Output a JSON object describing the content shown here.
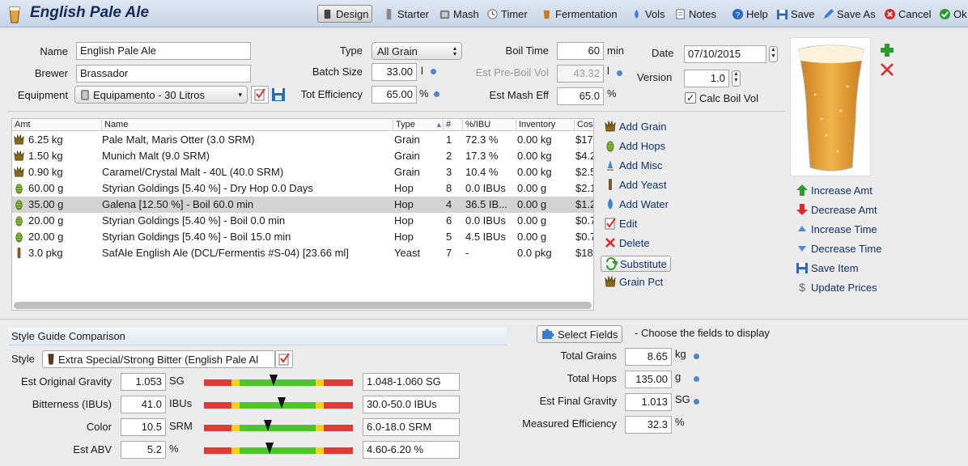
{
  "window": {
    "title": "English Pale Ale"
  },
  "toolbar": [
    {
      "label": "Design",
      "icon": "design-icon",
      "active": true
    },
    {
      "label": "Starter",
      "icon": "starter-icon"
    },
    {
      "label": "Mash",
      "icon": "mash-icon"
    },
    {
      "label": "Timer",
      "icon": "timer-icon"
    },
    {
      "label": "Fermentation",
      "icon": "fermentation-icon"
    },
    {
      "label": "Vols",
      "icon": "vols-icon"
    },
    {
      "label": "Notes",
      "icon": "notes-icon"
    },
    {
      "label": "Help",
      "icon": "help-icon"
    },
    {
      "label": "Save",
      "icon": "save-icon"
    },
    {
      "label": "Save As",
      "icon": "save-as-icon"
    },
    {
      "label": "Cancel",
      "icon": "cancel-icon"
    },
    {
      "label": "Ok",
      "icon": "ok-icon"
    }
  ],
  "recipe": {
    "name_label": "Name",
    "name": "English Pale Ale",
    "brewer_label": "Brewer",
    "brewer": "Brassador",
    "equipment_label": "Equipment",
    "equipment": "Equipamento - 30 Litros",
    "type_label": "Type",
    "type": "All Grain",
    "batch_label": "Batch Size",
    "batch": "33.00",
    "batch_unit": "l",
    "eff_label": "Tot Efficiency",
    "eff": "65.00",
    "eff_unit": "%",
    "boil_label": "Boil Time",
    "boil": "60",
    "boil_unit": "min",
    "preboil_label": "Est Pre-Boil Vol",
    "preboil": "43.32",
    "preboil_unit": "l",
    "mash_eff_label": "Est Mash Eff",
    "mash_eff": "65.0",
    "mash_eff_unit": "%",
    "date_label": "Date",
    "date": "07/10/2015",
    "version_label": "Version",
    "version": "1.0",
    "calc_boil_label": "Calc Boil Vol",
    "calc_boil": true
  },
  "ingredients": {
    "columns": [
      "Amt",
      "Name",
      "Type",
      "#",
      "%/IBU",
      "Inventory",
      "Cos"
    ],
    "rows": [
      {
        "icon": "grain-icon",
        "amt": "6.25 kg",
        "name": "Pale Malt, Maris Otter (3.0 SRM)",
        "type": "Grain",
        "num": "1",
        "pct": "72.3 %",
        "inv": "0.00 kg",
        "cost": "$17"
      },
      {
        "icon": "grain-icon",
        "amt": "1.50 kg",
        "name": "Munich Malt (9.0 SRM)",
        "type": "Grain",
        "num": "2",
        "pct": "17.3 %",
        "inv": "0.00 kg",
        "cost": "$4.2"
      },
      {
        "icon": "grain-icon",
        "amt": "0.90 kg",
        "name": "Caramel/Crystal Malt - 40L (40.0 SRM)",
        "type": "Grain",
        "num": "3",
        "pct": "10.4 %",
        "inv": "0.00 kg",
        "cost": "$2.5"
      },
      {
        "icon": "hop-icon",
        "amt": "60.00 g",
        "name": "Styrian Goldings [5.40 %] - Dry Hop 0.0 Days",
        "type": "Hop",
        "num": "8",
        "pct": "0.0 IBUs",
        "inv": "0.00 g",
        "cost": "$2.1"
      },
      {
        "icon": "hop-icon",
        "amt": "35.00 g",
        "name": "Galena [12.50 %] - Boil 60.0 min",
        "type": "Hop",
        "num": "4",
        "pct": "36.5 IB...",
        "inv": "0.00 g",
        "cost": "$1.2",
        "selected": true
      },
      {
        "icon": "hop-icon",
        "amt": "20.00 g",
        "name": "Styrian Goldings [5.40 %] - Boil 0.0 min",
        "type": "Hop",
        "num": "6",
        "pct": "0.0 IBUs",
        "inv": "0.00 g",
        "cost": "$0.7"
      },
      {
        "icon": "hop-icon",
        "amt": "20.00 g",
        "name": "Styrian Goldings [5.40 %] - Boil 15.0 min",
        "type": "Hop",
        "num": "5",
        "pct": "4.5 IBUs",
        "inv": "0.00 g",
        "cost": "$0.7"
      },
      {
        "icon": "yeast-icon",
        "amt": "3.0 pkg",
        "name": "SafAle English Ale (DCL/Fermentis #S-04) [23.66 ml]",
        "type": "Yeast",
        "num": "7",
        "pct": "-",
        "inv": "0.0 pkg",
        "cost": "$18"
      }
    ]
  },
  "side_buttons": [
    {
      "label": "Add Grain",
      "icon": "grain-icon"
    },
    {
      "label": "Add Hops",
      "icon": "hop-icon"
    },
    {
      "label": "Add Misc",
      "icon": "misc-icon"
    },
    {
      "label": "Add Yeast",
      "icon": "yeast-icon"
    },
    {
      "label": "Add Water",
      "icon": "water-icon"
    },
    {
      "label": "Edit",
      "icon": "edit-icon"
    },
    {
      "label": "Delete",
      "icon": "delete-icon"
    },
    {
      "label": "Substitute",
      "icon": "substitute-icon"
    },
    {
      "label": "Grain Pct",
      "icon": "grain-icon"
    }
  ],
  "right_buttons": [
    {
      "label": "Increase Amt",
      "icon": "arrow-up-icon"
    },
    {
      "label": "Decrease Amt",
      "icon": "arrow-down-icon"
    },
    {
      "label": "Increase Time",
      "icon": "triangle-up-icon"
    },
    {
      "label": "Decrease Time",
      "icon": "triangle-down-icon"
    },
    {
      "label": "Save Item",
      "icon": "save-icon"
    },
    {
      "label": "Update Prices",
      "icon": "dollar-icon"
    }
  ],
  "style_guide": {
    "title": "Style Guide Comparison",
    "style_label": "Style",
    "style": "Extra Special/Strong Bitter (English Pale Al",
    "rows": [
      {
        "label": "Est Original Gravity",
        "value": "1.053",
        "unit": "SG",
        "range": "1.048-1.060 SG",
        "level": 0.47
      },
      {
        "label": "Bitterness (IBUs)",
        "value": "41.0",
        "unit": "IBUs",
        "range": "30.0-50.0 IBUs",
        "level": 0.52
      },
      {
        "label": "Color",
        "value": "10.5",
        "unit": "SRM",
        "range": "6.0-18.0 SRM",
        "level": 0.43
      },
      {
        "label": "Est ABV",
        "value": "5.2",
        "unit": "%",
        "range": "4.60-6.20 %",
        "level": 0.44
      }
    ]
  },
  "stats": {
    "select_fields_label": "Select Fields",
    "hint": "- Choose the fields to display",
    "rows": [
      {
        "label": "Total Grains",
        "value": "8.65",
        "unit": "kg"
      },
      {
        "label": "Total Hops",
        "value": "135.00",
        "unit": "g"
      },
      {
        "label": "Est Final Gravity",
        "value": "1.013",
        "unit": "SG"
      },
      {
        "label": "Measured Efficiency",
        "value": "32.3",
        "unit": "%"
      }
    ]
  },
  "colors": {
    "title_text": "#15295c",
    "link_text": "#10306a",
    "bar_red": "#e03b3b",
    "bar_yellow": "#f2d21a",
    "bar_green": "#4cc62c",
    "beer_amber": "#e8a23a"
  }
}
